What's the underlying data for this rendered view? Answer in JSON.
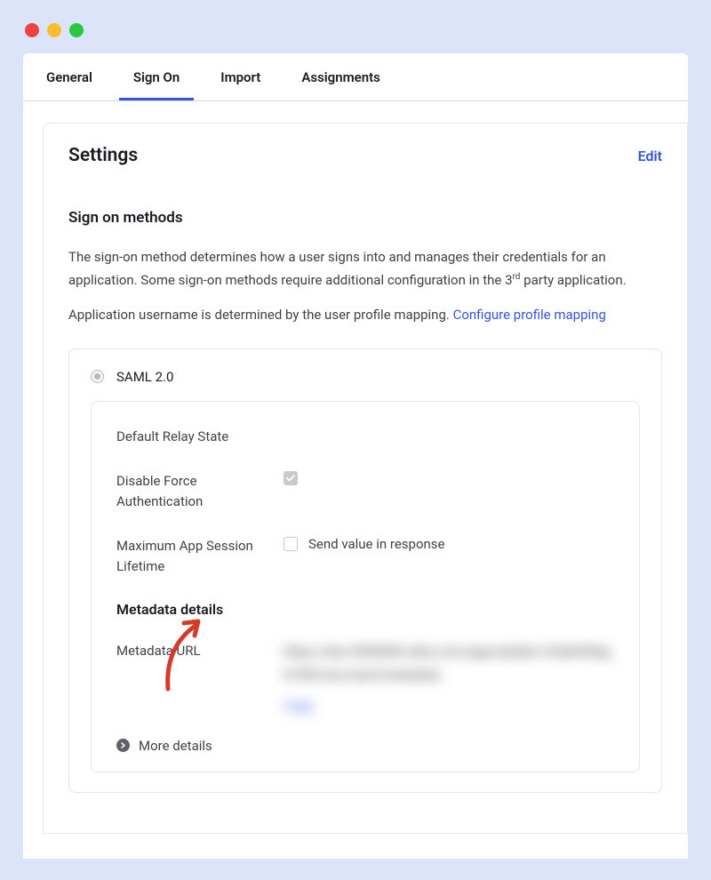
{
  "tabs": [
    {
      "label": "General",
      "active": false
    },
    {
      "label": "Sign On",
      "active": true
    },
    {
      "label": "Import",
      "active": false
    },
    {
      "label": "Assignments",
      "active": false
    }
  ],
  "panel": {
    "title": "Settings",
    "edit_label": "Edit"
  },
  "signon": {
    "heading": "Sign on methods",
    "desc1a": "The sign-on method determines how a user signs into and manages their credentials for an application. Some sign-on methods require additional configuration in the 3",
    "desc1_sup": "rd",
    "desc1b": " party application.",
    "desc2a": "Application username is determined by the user profile mapping. ",
    "configure_link": "Configure profile mapping"
  },
  "saml": {
    "radio_label": "SAML 2.0",
    "fields": {
      "relay_state": "Default Relay State",
      "disable_force_auth": "Disable Force Authentication",
      "max_session": "Maximum App Session Lifetime",
      "send_value": "Send value in response"
    },
    "metadata": {
      "heading": "Metadata details",
      "url_label": "Metadata URL",
      "blur_text": "https://dev-0000000.okta.com/app/exkabc123def456ghi789/sso/saml/metadata",
      "blur_action": "Copy"
    },
    "more_details": "More details"
  }
}
